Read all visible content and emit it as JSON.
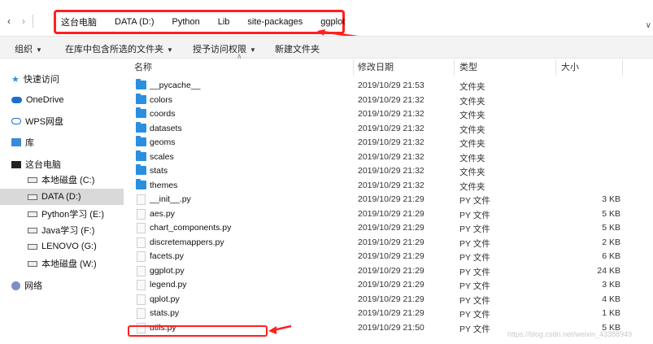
{
  "address_bar": {
    "breadcrumbs": [
      "这台电脑",
      "DATA (D:)",
      "Python",
      "Lib",
      "site-packages",
      "ggplot"
    ]
  },
  "toolbar": {
    "organize": "组织",
    "include_in_library": "在库中包含所选的文件夹",
    "share_with": "授予访问权限",
    "new_folder": "新建文件夹"
  },
  "sidebar": {
    "quick_access": "快速访问",
    "onedrive": "OneDrive",
    "wps": "WPS网盘",
    "library": "库",
    "this_pc": "这台电脑",
    "drives": [
      {
        "label": "本地磁盘 (C:)",
        "selected": false
      },
      {
        "label": "DATA (D:)",
        "selected": true
      },
      {
        "label": "Python学习 (E:)",
        "selected": false
      },
      {
        "label": "Java学习 (F:)",
        "selected": false
      },
      {
        "label": "LENOVO (G:)",
        "selected": false
      },
      {
        "label": "本地磁盘 (W:)",
        "selected": false
      }
    ],
    "network": "网络"
  },
  "columns": {
    "name": "名称",
    "date": "修改日期",
    "type": "类型",
    "size": "大小"
  },
  "files": [
    {
      "name": "__pycache__",
      "date": "2019/10/29 21:53",
      "type": "文件夹",
      "size": "",
      "kind": "folder"
    },
    {
      "name": "colors",
      "date": "2019/10/29 21:32",
      "type": "文件夹",
      "size": "",
      "kind": "folder"
    },
    {
      "name": "coords",
      "date": "2019/10/29 21:32",
      "type": "文件夹",
      "size": "",
      "kind": "folder"
    },
    {
      "name": "datasets",
      "date": "2019/10/29 21:32",
      "type": "文件夹",
      "size": "",
      "kind": "folder"
    },
    {
      "name": "geoms",
      "date": "2019/10/29 21:32",
      "type": "文件夹",
      "size": "",
      "kind": "folder"
    },
    {
      "name": "scales",
      "date": "2019/10/29 21:32",
      "type": "文件夹",
      "size": "",
      "kind": "folder"
    },
    {
      "name": "stats",
      "date": "2019/10/29 21:32",
      "type": "文件夹",
      "size": "",
      "kind": "folder"
    },
    {
      "name": "themes",
      "date": "2019/10/29 21:32",
      "type": "文件夹",
      "size": "",
      "kind": "folder"
    },
    {
      "name": "__init__.py",
      "date": "2019/10/29 21:29",
      "type": "PY 文件",
      "size": "3 KB",
      "kind": "file"
    },
    {
      "name": "aes.py",
      "date": "2019/10/29 21:29",
      "type": "PY 文件",
      "size": "5 KB",
      "kind": "file"
    },
    {
      "name": "chart_components.py",
      "date": "2019/10/29 21:29",
      "type": "PY 文件",
      "size": "5 KB",
      "kind": "file"
    },
    {
      "name": "discretemappers.py",
      "date": "2019/10/29 21:29",
      "type": "PY 文件",
      "size": "2 KB",
      "kind": "file"
    },
    {
      "name": "facets.py",
      "date": "2019/10/29 21:29",
      "type": "PY 文件",
      "size": "6 KB",
      "kind": "file"
    },
    {
      "name": "ggplot.py",
      "date": "2019/10/29 21:29",
      "type": "PY 文件",
      "size": "24 KB",
      "kind": "file"
    },
    {
      "name": "legend.py",
      "date": "2019/10/29 21:29",
      "type": "PY 文件",
      "size": "3 KB",
      "kind": "file"
    },
    {
      "name": "qplot.py",
      "date": "2019/10/29 21:29",
      "type": "PY 文件",
      "size": "4 KB",
      "kind": "file"
    },
    {
      "name": "stats.py",
      "date": "2019/10/29 21:29",
      "type": "PY 文件",
      "size": "1 KB",
      "kind": "file"
    },
    {
      "name": "utils.py",
      "date": "2019/10/29 21:50",
      "type": "PY 文件",
      "size": "5 KB",
      "kind": "file"
    }
  ],
  "watermark": "https://blog.csdn.net/weixin_43388949",
  "colors": {
    "annotation_red": "#ff2020",
    "folder_blue": "#2b8fe0",
    "selection_gray": "#d9d9d9"
  }
}
